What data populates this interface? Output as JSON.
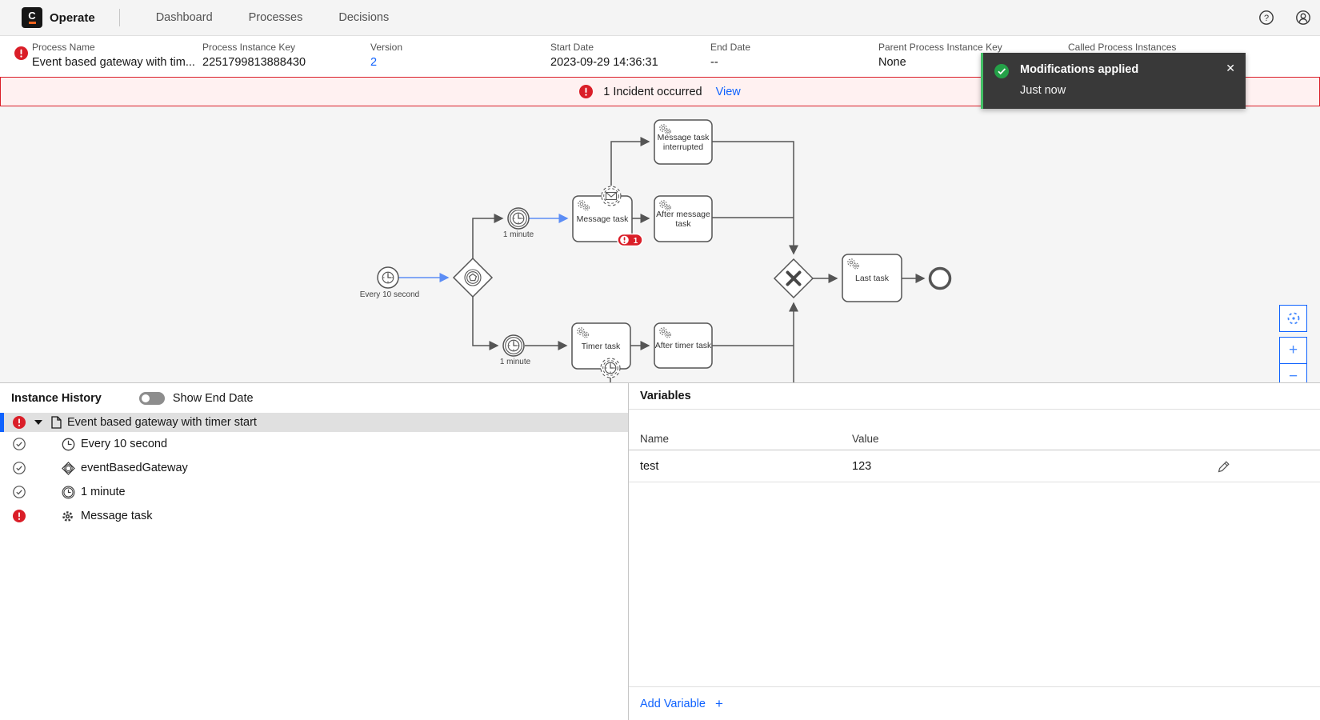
{
  "colors": {
    "accent": "#0f62fe",
    "danger": "#da1e28",
    "success": "#24a148",
    "toast_bg": "#393939"
  },
  "icons": {
    "help": "?",
    "close": "✕",
    "zoom_in": "+",
    "zoom_out": "−",
    "add_plus": "+"
  },
  "topnav": {
    "logo_letter": "C",
    "app_name": "Operate",
    "items": [
      {
        "label": "Dashboard"
      },
      {
        "label": "Processes"
      },
      {
        "label": "Decisions"
      }
    ]
  },
  "infobar": {
    "fields": [
      {
        "label": "Process Name",
        "value": "Event based gateway with tim..."
      },
      {
        "label": "Process Instance Key",
        "value": "2251799813888430"
      },
      {
        "label": "Version",
        "value": "2"
      },
      {
        "label": "Start Date",
        "value": "2023-09-29 14:36:31"
      },
      {
        "label": "End Date",
        "value": "--"
      },
      {
        "label": "Parent Process Instance Key",
        "value": "None"
      },
      {
        "label": "Called Process Instances",
        "value": ""
      }
    ]
  },
  "banner": {
    "text": "1 Incident occurred",
    "action": "View"
  },
  "toast": {
    "title": "Modifications applied",
    "time": "Just now"
  },
  "diagram": {
    "start_event_label": "Every 10 second",
    "timer_upper_label": "1 minute",
    "timer_lower_label": "1 minute",
    "message_task_label": "Message task",
    "message_task_interrupted_line1": "Message task",
    "message_task_interrupted_line2": "interrupted",
    "after_message_task_line1": "After message",
    "after_message_task_line2": "task",
    "timer_task_label": "Timer task",
    "after_timer_task_label": "After timer task",
    "last_task_label": "Last task",
    "incident_count": "1"
  },
  "history": {
    "title": "Instance History",
    "toggle_label": "Show End Date",
    "root_label": "Event based gateway with timer start",
    "rows": [
      {
        "label": "Every 10 second",
        "state": "completed",
        "icon": "timer-start"
      },
      {
        "label": "eventBasedGateway",
        "state": "completed",
        "icon": "event-based-gateway"
      },
      {
        "label": "1 minute",
        "state": "completed",
        "icon": "timer-intermediate"
      },
      {
        "label": "Message task",
        "state": "incident",
        "icon": "service-task"
      }
    ]
  },
  "variables": {
    "title": "Variables",
    "col_name": "Name",
    "col_value": "Value",
    "rows": [
      {
        "name": "test",
        "value": "123"
      }
    ],
    "add_label": "Add Variable"
  }
}
